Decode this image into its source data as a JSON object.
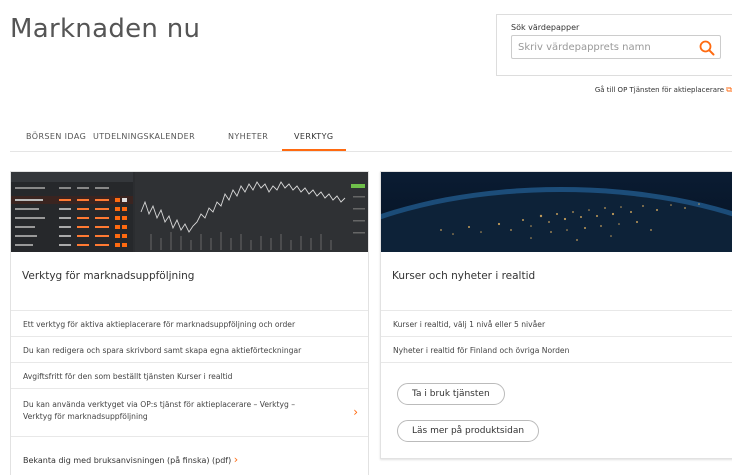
{
  "page": {
    "title": "Marknaden nu"
  },
  "search": {
    "label": "Sök värdepapper",
    "placeholder": "Skriv värdepapprets namn"
  },
  "op_link": {
    "text": "Gå till OP Tjänsten för aktieplacerare"
  },
  "tabs": [
    {
      "label": "BÖRSEN IDAG",
      "active": false
    },
    {
      "label": "UTDELNINGSKALENDER",
      "active": false
    },
    {
      "label": "NYHETER",
      "active": false
    },
    {
      "label": "VERKTYG",
      "active": true
    }
  ],
  "cards": [
    {
      "title": "Verktyg för marknadsuppföljning",
      "rows": [
        "Ett verktyg för aktiva aktieplacerare för marknadsuppföljning och order",
        "Du kan redigera och spara skrivbord samt skapa egna aktieförteckningar",
        "Avgiftsfritt för den som beställt tjänsten Kurser i realtid",
        "Du kan använda verktyget via OP:s tjänst för aktieplacerare – Verktyg – Verktyg för marknadsuppföljning"
      ],
      "bottom_link": "Bekanta dig med bruksanvisningen (på finska) (pdf)"
    },
    {
      "title": "Kurser och nyheter i realtid",
      "rows": [
        "Kurser i realtid, välj 1 nivå eller 5 nivåer",
        "Nyheter i realtid för Finland och övriga Norden"
      ],
      "buttons": [
        "Ta i bruk tjänsten",
        "Läs mer på produktsidan"
      ]
    }
  ],
  "colors": {
    "accent": "#ff6a10",
    "text": "#333333",
    "border": "#e2e2e2"
  },
  "icons": [
    "search-icon",
    "external-link-icon",
    "chevron-right-icon"
  ]
}
